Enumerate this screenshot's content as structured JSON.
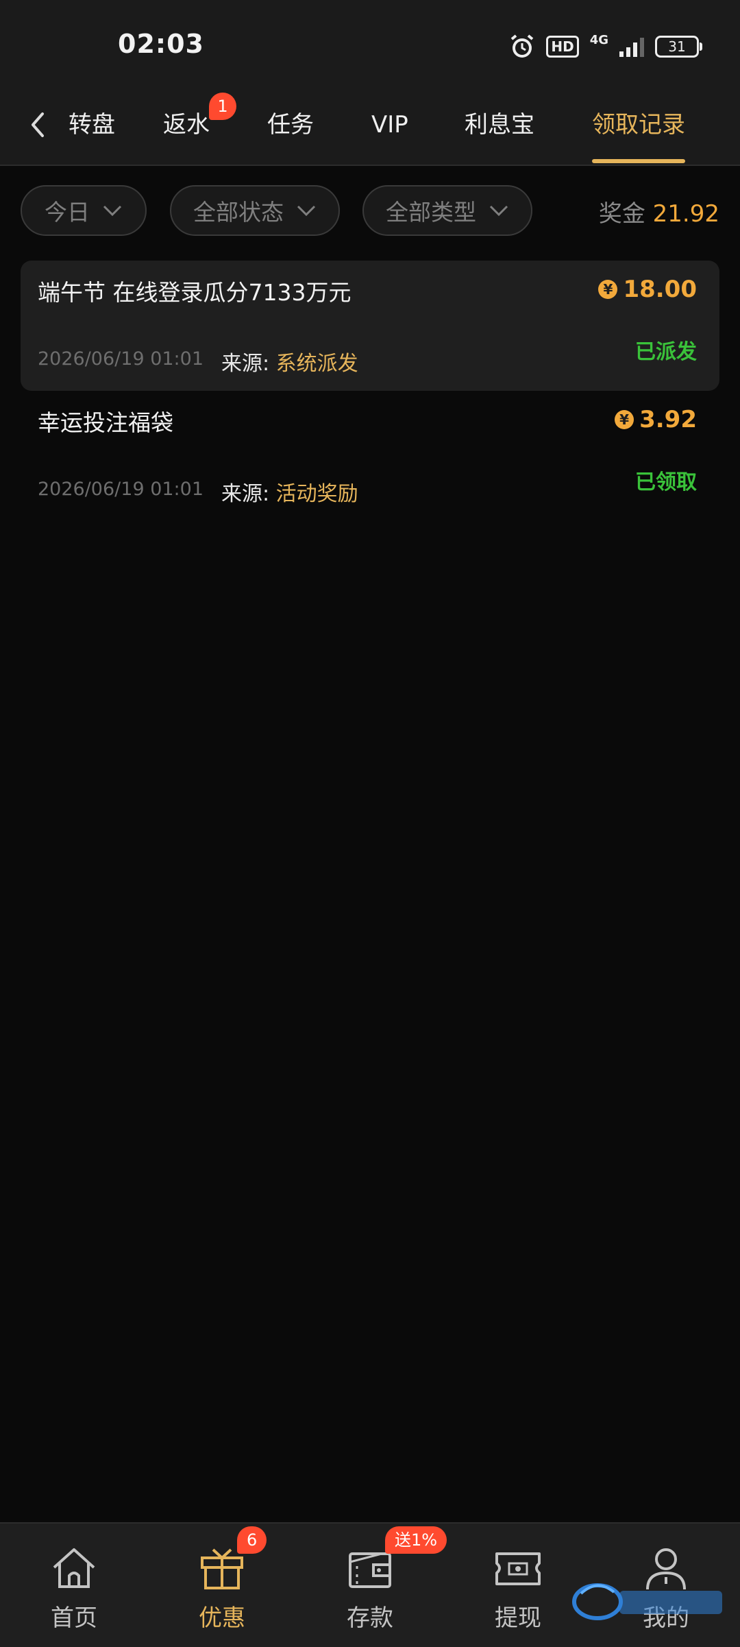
{
  "status_bar": {
    "time": "02:03",
    "hd": "HD",
    "network": "4G",
    "battery": "31"
  },
  "tabs": [
    {
      "label": "转盘",
      "active": false
    },
    {
      "label": "返水",
      "active": false,
      "badge": "1"
    },
    {
      "label": "任务",
      "active": false
    },
    {
      "label": "VIP",
      "active": false
    },
    {
      "label": "利息宝",
      "active": false
    },
    {
      "label": "领取记录",
      "active": true
    }
  ],
  "filters": {
    "date": "今日",
    "status": "全部状态",
    "type": "全部类型",
    "bonus_label": "奖金",
    "bonus_value": "21.92"
  },
  "records": [
    {
      "title": "端午节 在线登录瓜分7133万元",
      "amount": "18.00",
      "status": "已派发",
      "datetime": "2026/06/19 01:01",
      "source_label": "来源:",
      "source_value": "系统派发"
    },
    {
      "title": "幸运投注福袋",
      "amount": "3.92",
      "status": "已领取",
      "datetime": "2026/06/19 01:01",
      "source_label": "来源:",
      "source_value": "活动奖励"
    }
  ],
  "currency_symbol": "¥",
  "bottom_nav": [
    {
      "label": "首页",
      "icon": "home-icon"
    },
    {
      "label": "优惠",
      "icon": "gift-icon",
      "badge": "6",
      "active": true
    },
    {
      "label": "存款",
      "icon": "wallet-icon",
      "badge": "送1%"
    },
    {
      "label": "提现",
      "icon": "ticket-icon"
    },
    {
      "label": "我的",
      "icon": "user-icon"
    }
  ],
  "colors": {
    "accent": "#e6b55b",
    "amount": "#f2a93b",
    "status_green": "#3ac23a",
    "badge_red": "#ff4a2f",
    "background": "#0a0a0a"
  }
}
